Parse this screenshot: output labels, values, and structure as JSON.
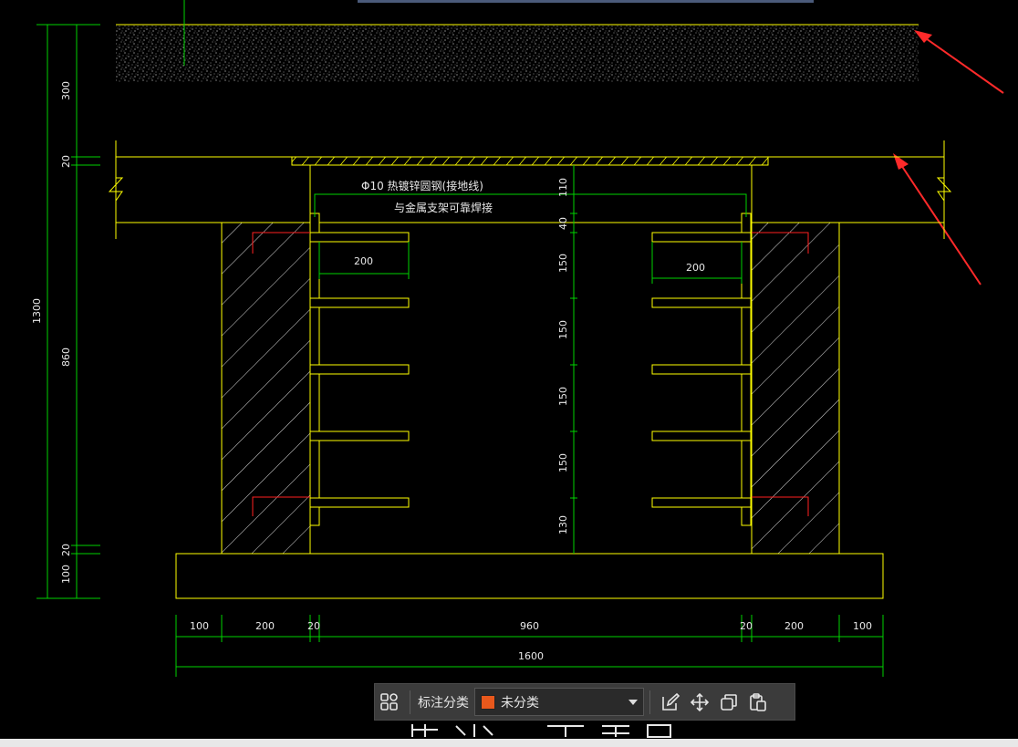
{
  "colors": {
    "line": "#ffff00",
    "dim": "#00d200",
    "red": "#ff2020",
    "arrow": "#ff2a2a",
    "hatch": "#e8e8e8",
    "soil": "#d0d0d0",
    "topbar": "#4a5a7a",
    "swatch": "#e8581c"
  },
  "drawing": {
    "note_line1": "Φ10  热镀锌圆钢(接地线)",
    "note_line2": "与金属支架可靠焊接",
    "left_dims": {
      "total": "1300",
      "top": "300",
      "cover": "20",
      "mid": "860",
      "bottom_a": "20",
      "bottom_b": "100"
    },
    "center_dims": [
      "110",
      "40",
      "150",
      "150",
      "150",
      "150",
      "130"
    ],
    "bracket_dims": {
      "left": "200",
      "right": "200"
    },
    "bottom_dims": [
      "100",
      "200",
      "20",
      "960",
      "20",
      "200",
      "100"
    ],
    "total_width": "1600"
  },
  "toolbar": {
    "category_label": "标注分类",
    "category_value": "未分类"
  }
}
